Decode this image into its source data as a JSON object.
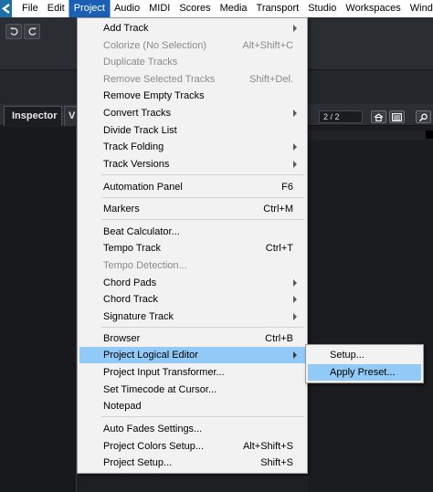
{
  "menubar": {
    "items": [
      "File",
      "Edit",
      "Project",
      "Audio",
      "MIDI",
      "Scores",
      "Media",
      "Transport",
      "Studio",
      "Workspaces",
      "Windo"
    ],
    "active_index": 2
  },
  "inspector": {
    "tab_label": "Inspector",
    "tab2_label": "V",
    "counter": "2 / 2"
  },
  "project_menu": {
    "items": [
      {
        "label": "Add Track",
        "shortcut": "",
        "submenu": true,
        "disabled": false
      },
      {
        "label": "Colorize (No Selection)",
        "shortcut": "Alt+Shift+C",
        "submenu": false,
        "disabled": true
      },
      {
        "label": "Duplicate Tracks",
        "shortcut": "",
        "submenu": false,
        "disabled": true
      },
      {
        "label": "Remove Selected Tracks",
        "shortcut": "Shift+Del.",
        "submenu": false,
        "disabled": true
      },
      {
        "label": "Remove Empty Tracks",
        "shortcut": "",
        "submenu": false,
        "disabled": false
      },
      {
        "label": "Convert Tracks",
        "shortcut": "",
        "submenu": true,
        "disabled": false
      },
      {
        "label": "Divide Track List",
        "shortcut": "",
        "submenu": false,
        "disabled": false
      },
      {
        "label": "Track Folding",
        "shortcut": "",
        "submenu": true,
        "disabled": false
      },
      {
        "label": "Track Versions",
        "shortcut": "",
        "submenu": true,
        "disabled": false
      },
      {
        "label": "Automation Panel",
        "shortcut": "F6",
        "submenu": false,
        "disabled": false
      },
      {
        "label": "Markers",
        "shortcut": "Ctrl+M",
        "submenu": false,
        "disabled": false
      },
      {
        "label": "Beat Calculator...",
        "shortcut": "",
        "submenu": false,
        "disabled": false
      },
      {
        "label": "Tempo Track",
        "shortcut": "Ctrl+T",
        "submenu": false,
        "disabled": false
      },
      {
        "label": "Tempo Detection...",
        "shortcut": "",
        "submenu": false,
        "disabled": true
      },
      {
        "label": "Chord Pads",
        "shortcut": "",
        "submenu": true,
        "disabled": false
      },
      {
        "label": "Chord Track",
        "shortcut": "",
        "submenu": true,
        "disabled": false
      },
      {
        "label": "Signature Track",
        "shortcut": "",
        "submenu": true,
        "disabled": false
      },
      {
        "label": "Browser",
        "shortcut": "Ctrl+B",
        "submenu": false,
        "disabled": false
      },
      {
        "label": "Project Logical Editor",
        "shortcut": "",
        "submenu": true,
        "disabled": false,
        "highlighted": true
      },
      {
        "label": "Project Input Transformer...",
        "shortcut": "",
        "submenu": false,
        "disabled": false
      },
      {
        "label": "Set Timecode at Cursor...",
        "shortcut": "",
        "submenu": false,
        "disabled": false
      },
      {
        "label": "Notepad",
        "shortcut": "",
        "submenu": false,
        "disabled": false
      },
      {
        "label": "Auto Fades Settings...",
        "shortcut": "",
        "submenu": false,
        "disabled": false
      },
      {
        "label": "Project Colors Setup...",
        "shortcut": "Alt+Shift+S",
        "submenu": false,
        "disabled": false
      },
      {
        "label": "Project Setup...",
        "shortcut": "Shift+S",
        "submenu": false,
        "disabled": false
      }
    ]
  },
  "logical_editor_submenu": {
    "items": [
      {
        "label": "Setup...",
        "highlighted": false
      },
      {
        "label": "Apply Preset...",
        "highlighted": true
      }
    ]
  },
  "colors": {
    "menubar_active": "#1a5fb4",
    "menu_highlight": "#91c9f7",
    "app_logo": "#1c6fa8"
  }
}
